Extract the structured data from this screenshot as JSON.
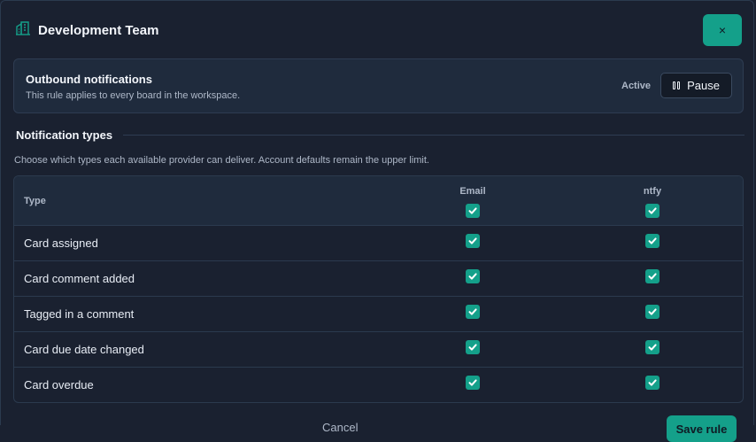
{
  "header": {
    "title": "Development Team",
    "icon": "building-icon",
    "close_icon": "×"
  },
  "rule": {
    "title": "Outbound notifications",
    "description": "This rule applies to every board in the workspace.",
    "status": "Active",
    "pause_label": "Pause"
  },
  "section": {
    "title": "Notification types",
    "description": "Choose which types each available provider can deliver. Account defaults remain the upper limit."
  },
  "table": {
    "type_header": "Type",
    "columns": [
      "Email",
      "ntfy"
    ],
    "header_checked": [
      true,
      true
    ],
    "rows": [
      {
        "label": "Card assigned",
        "email": true,
        "ntfy": true
      },
      {
        "label": "Card comment added",
        "email": true,
        "ntfy": true
      },
      {
        "label": "Tagged in a comment",
        "email": true,
        "ntfy": true
      },
      {
        "label": "Card due date changed",
        "email": true,
        "ntfy": true
      },
      {
        "label": "Card overdue",
        "email": true,
        "ntfy": true
      }
    ]
  },
  "footer": {
    "cancel_label": "Cancel",
    "save_label": "Save rule"
  },
  "colors": {
    "accent": "#14a08a",
    "background": "#1a2130",
    "panel": "#1f2b3d"
  }
}
